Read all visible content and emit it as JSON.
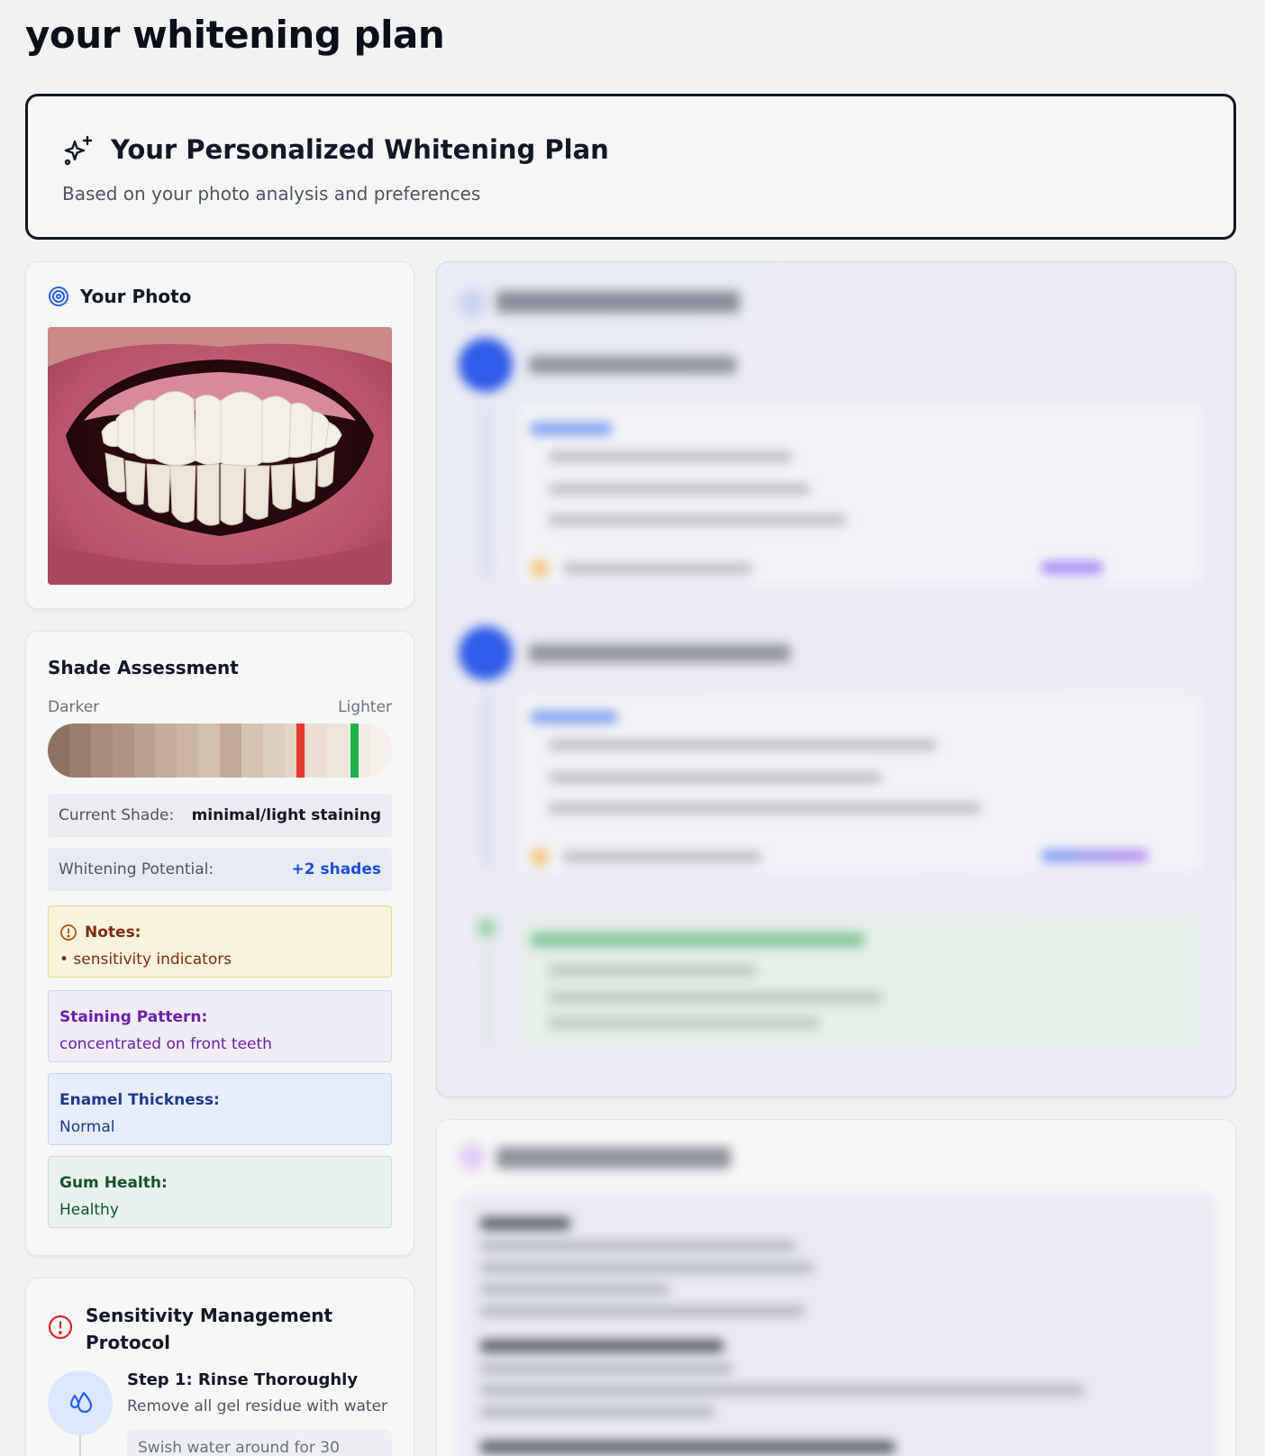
{
  "page_title": "your whitening plan",
  "plan": {
    "title": "Your Personalized Whitening Plan",
    "subtitle": "Based on your photo analysis and preferences"
  },
  "photo": {
    "title": "Your Photo"
  },
  "shade": {
    "title": "Shade Assessment",
    "darker_label": "Darker",
    "lighter_label": "Lighter",
    "swatches": [
      "#8e7260",
      "#9b7f6d",
      "#a88d7a",
      "#b09482",
      "#b8a08e",
      "#c3ad9b",
      "#cbb6a4",
      "#d2bfad",
      "#c2aa96",
      "#d5c4b2",
      "#dccdbc",
      "#e4d6c6",
      "#eadfd1",
      "#eee6da",
      "#f2ede4",
      "#f5f1ea"
    ],
    "current_marker_color": "#e53a2e",
    "target_marker_color": "#20b24a",
    "current_label": "Current Shade:",
    "current_value": "minimal/light staining",
    "potential_label": "Whitening Potential:",
    "potential_value": "+2 shades",
    "notes_label": "Notes:",
    "notes_item": "• sensitivity indicators",
    "staining_label": "Staining Pattern:",
    "staining_value": "concentrated on front teeth",
    "enamel_label": "Enamel Thickness:",
    "enamel_value": "Normal",
    "gum_label": "Gum Health:",
    "gum_value": "Healthy"
  },
  "sensitivity": {
    "title": "Sensitivity Management Protocol",
    "step1_title": "Step 1: Rinse Thoroughly",
    "step1_desc": "Remove all gel residue with water",
    "step1_tip": "Swish water around for 30"
  },
  "colors": {
    "accent_blue": "#1d4ed8",
    "notes_bg": "#f7f3dc",
    "staining_bg": "#f0ecf6",
    "enamel_bg": "#e6edf8",
    "gum_bg": "#e8f2ec"
  }
}
